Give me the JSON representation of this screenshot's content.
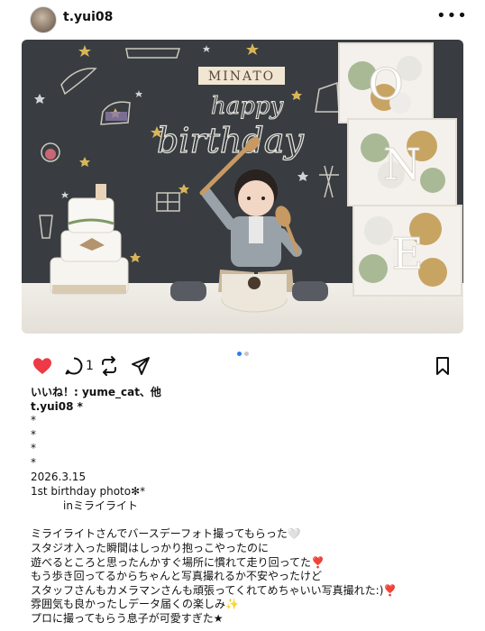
{
  "header": {
    "username": "t.yui08",
    "more_icon": "•••"
  },
  "photo": {
    "sign_text": "MINATO",
    "chalk_line1": "happy",
    "chalk_line2": "birthday",
    "blocks": [
      "O",
      "N",
      "E"
    ]
  },
  "carousel": {
    "total": 2,
    "active": 0
  },
  "actions": {
    "comment_count": "1",
    "like_color": "#ed3a45"
  },
  "post": {
    "likes_line": "いいね！: yume_cat、他",
    "author_line": "t.yui08 *",
    "bullets": [
      "*",
      "*",
      "*",
      "*"
    ],
    "date": "2026.3.15",
    "title": "1st birthday photo✻*",
    "location": "　　　inミライライト",
    "lines": [
      "ミライライトさんでバースデーフォト撮ってもらった🤍",
      "スタジオ入った瞬間はしっかり抱っこやったのに",
      "遊べるところと思ったんかすぐ場所に慣れて走り回ってた❣️",
      "もう歩き回ってるからちゃんと写真撮れるか不安やったけど",
      "スタッフさんもカメラマンさんも頑張ってくれてめちゃいい写真撮れた:)❣️",
      "雰囲気も良かったしデータ届くの楽しみ✨",
      "プロに撮ってもらう息子が可愛すぎた★"
    ]
  }
}
